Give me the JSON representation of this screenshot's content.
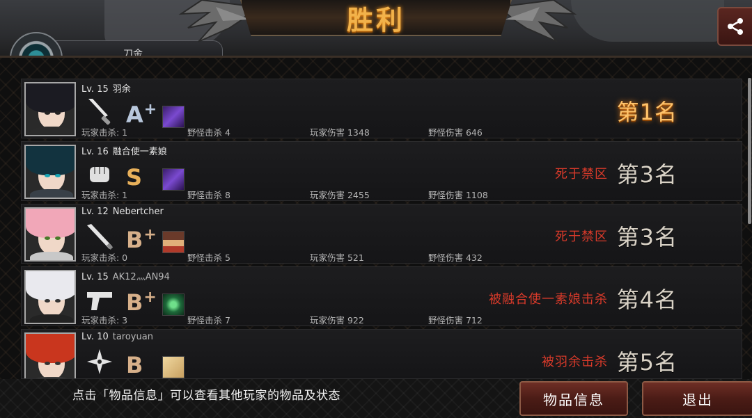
{
  "header": {
    "title": "胜利",
    "name_tab_text": "刀金"
  },
  "colors": {
    "accent_gold": "#f2b24a",
    "death_red": "#d83a2a",
    "button_red": "#4b1c16",
    "grade_A": "#b8c7dc",
    "grade_S": "#e8b05a",
    "grade_B": "#d7b08a"
  },
  "players": [
    {
      "level_label": "Lv. 15",
      "name": "羽余",
      "weapon_icon": "knife-icon",
      "grade": "A",
      "grade_plus": "+",
      "item_icon": "purple-item-icon",
      "stats": {
        "player_kills": "玩家击杀: 1",
        "monster_kills": "野怪击杀 4",
        "player_damage": "玩家伤害 1348",
        "monster_damage": "野怪伤害 646"
      },
      "death": "",
      "rank": "第1名"
    },
    {
      "level_label": "Lv. 16",
      "name": "融合使一素娘",
      "weapon_icon": "fist-icon",
      "grade": "S",
      "grade_plus": "",
      "item_icon": "purple-item-icon",
      "stats": {
        "player_kills": "玩家击杀: 1",
        "monster_kills": "野怪击杀 8",
        "player_damage": "玩家伤害 2455",
        "monster_damage": "野怪伤害 1108"
      },
      "death": "死于禁区",
      "rank": "第3名"
    },
    {
      "level_label": "Lv. 12",
      "name": "Nebertcher",
      "weapon_icon": "bat-icon",
      "grade": "B",
      "grade_plus": "+",
      "item_icon": "character-item-icon",
      "stats": {
        "player_kills": "玩家击杀: 0",
        "monster_kills": "野怪击杀 5",
        "player_damage": "玩家伤害 521",
        "monster_damage": "野怪伤害 432"
      },
      "death": "死于禁区",
      "rank": "第3名"
    },
    {
      "level_label": "Lv. 15",
      "name": "AK12灬AN94",
      "weapon_icon": "pistol-icon",
      "grade": "B",
      "grade_plus": "+",
      "item_icon": "green-item-icon",
      "stats": {
        "player_kills": "玩家击杀: 3",
        "monster_kills": "野怪击杀 7",
        "player_damage": "玩家伤害 922",
        "monster_damage": "野怪伤害 712"
      },
      "death": "被融合使一素娘击杀",
      "rank": "第4名"
    },
    {
      "level_label": "Lv. 10",
      "name": "taroyuan",
      "weapon_icon": "shuriken-icon",
      "grade": "B",
      "grade_plus": "",
      "item_icon": "scroll-item-icon",
      "stats": {
        "player_kills": "",
        "monster_kills": "",
        "player_damage": "",
        "monster_damage": ""
      },
      "death": "被羽余击杀",
      "rank": "第5名"
    }
  ],
  "footer": {
    "tip": "点击「物品信息」可以查看其他玩家的物品及状态",
    "items_button": "物品信息",
    "exit_button": "退出"
  }
}
